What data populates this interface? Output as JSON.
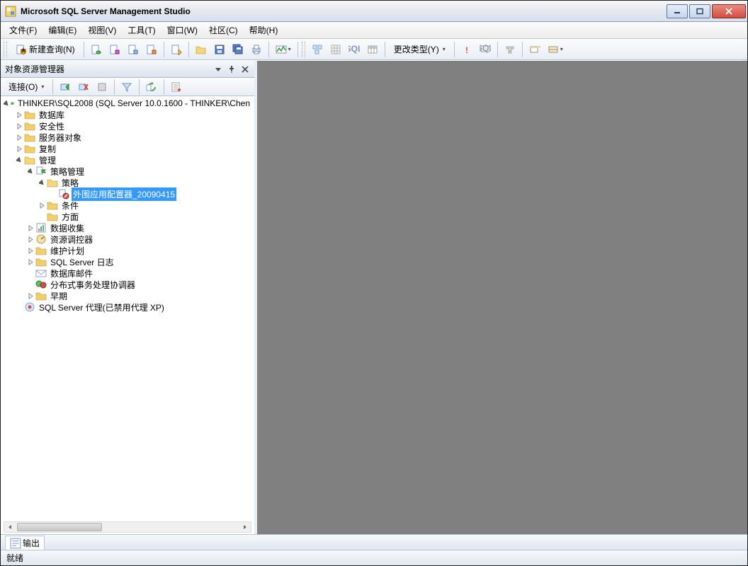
{
  "title": "Microsoft SQL Server Management Studio",
  "menubar": {
    "file": "文件(F)",
    "edit": "编辑(E)",
    "view": "视图(V)",
    "tools": "工具(T)",
    "window": "窗口(W)",
    "community": "社区(C)",
    "help": "帮助(H)"
  },
  "toolbar": {
    "new_query": "新建查询(N)",
    "change_type": "更改类型(Y)"
  },
  "panel": {
    "title": "对象资源管理器",
    "connect_label": "连接(O)"
  },
  "tree": {
    "server": "THINKER\\SQL2008 (SQL Server 10.0.1600 - THINKER\\Chen",
    "databases": "数据库",
    "security": "安全性",
    "server_objects": "服务器对象",
    "replication": "复制",
    "management": "管理",
    "policy_management": "策略管理",
    "policies": "策略",
    "selected_policy": "外围应用配置器_20090415",
    "conditions": "条件",
    "facets": "方面",
    "data_collection": "数据收集",
    "resource_governor": "资源调控器",
    "maintenance_plans": "维护计划",
    "sql_server_logs": "SQL Server 日志",
    "db_mail": "数据库邮件",
    "dtc": "分布式事务处理协调器",
    "legacy": "早期",
    "sql_agent": "SQL Server 代理(已禁用代理 XP)"
  },
  "output_tab": "输出",
  "status": "就绪"
}
